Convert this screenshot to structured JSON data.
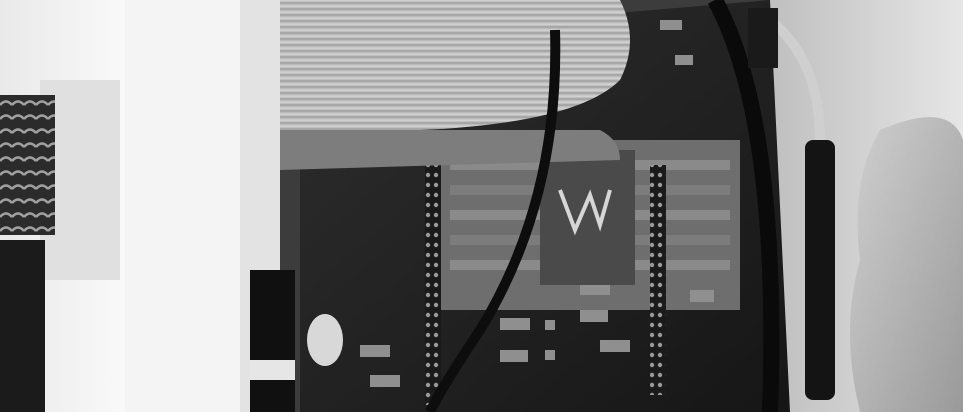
{
  "image": {
    "kind": "grayscale-photograph",
    "palette": {
      "background_wall": "#d8d8d8",
      "pcb_dark": "#1e1e1e",
      "pcb_mid": "#3a3a3a",
      "ribbon_light": "#bdbdbd",
      "ribbon_shadow": "#8a8a8a",
      "foam_white": "#f2f2f2",
      "cable_black": "#0d0d0d",
      "tube_clear": "#cfcfcf"
    }
  }
}
